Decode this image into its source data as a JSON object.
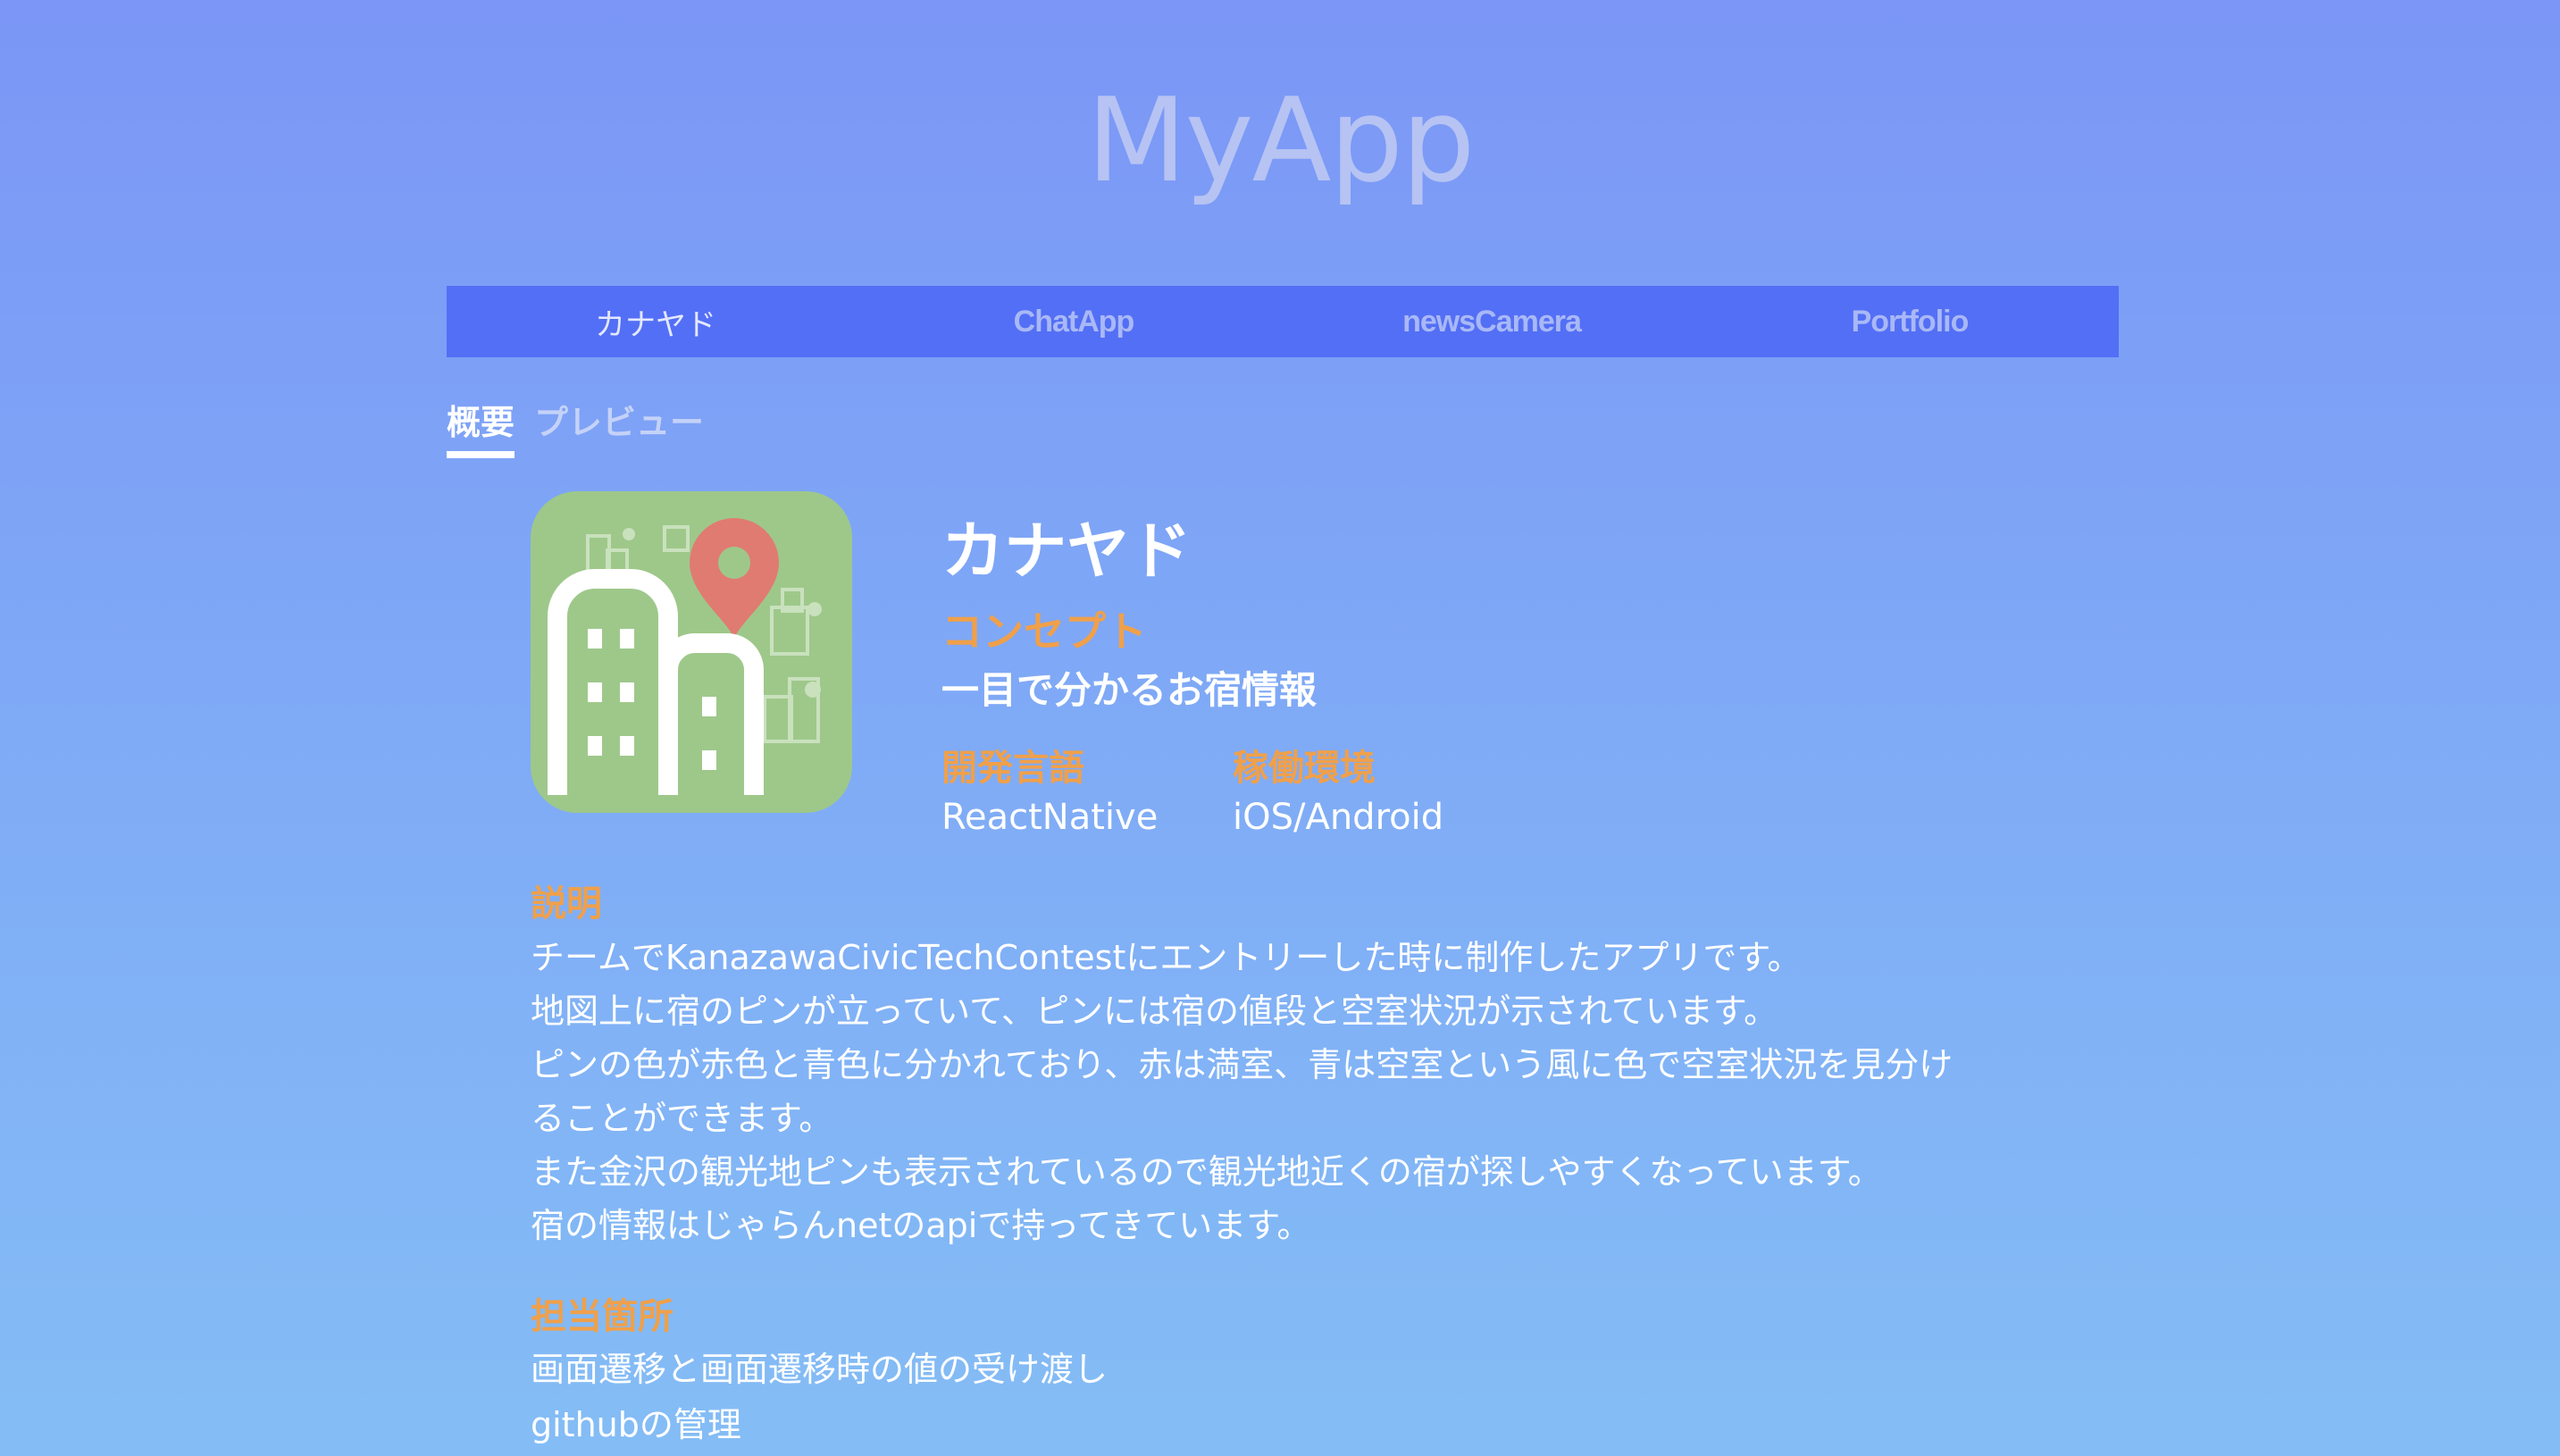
{
  "header": {
    "title": "MyApp"
  },
  "nav": {
    "items": [
      {
        "label": "カナヤド"
      },
      {
        "label": "ChatApp"
      },
      {
        "label": "newsCamera"
      },
      {
        "label": "Portfolio"
      }
    ]
  },
  "tabs": [
    {
      "label": "概要"
    },
    {
      "label": "プレビュー"
    }
  ],
  "app": {
    "icon": "city-map-pin-icon",
    "name": "カナヤド",
    "concept_label": "コンセプト",
    "concept": "一目で分かるお宿情報",
    "language_label": "開発言語",
    "language": "ReactNative",
    "environment_label": "稼働環境",
    "environment": "iOS/Android",
    "description_label": "説明",
    "description_lines": [
      "チームでKanazawaCivicTechContestにエントリーした時に制作したアプリです。",
      "地図上に宿のピンが立っていて、ピンには宿の値段と空室状況が示されています。",
      "ピンの色が赤色と青色に分かれており、赤は満室、青は空室という風に色で空室状況を見分け",
      "ることができます。",
      "また金沢の観光地ピンも表示されているので観光地近くの宿が探しやすくなっています。",
      "宿の情報はじゃらんnetのapiで持ってきています。"
    ],
    "responsibility_label": "担当箇所",
    "responsibility_lines": [
      "画面遷移と画面遷移時の値の受け渡し",
      "githubの管理"
    ]
  },
  "colors": {
    "background_top": "#7b96f6",
    "background_bottom": "#84bdf5",
    "nav_bar": "#536ff5",
    "label_accent": "#f0a04a",
    "icon_background": "#9ec88a",
    "pin_red": "#e07b72"
  }
}
